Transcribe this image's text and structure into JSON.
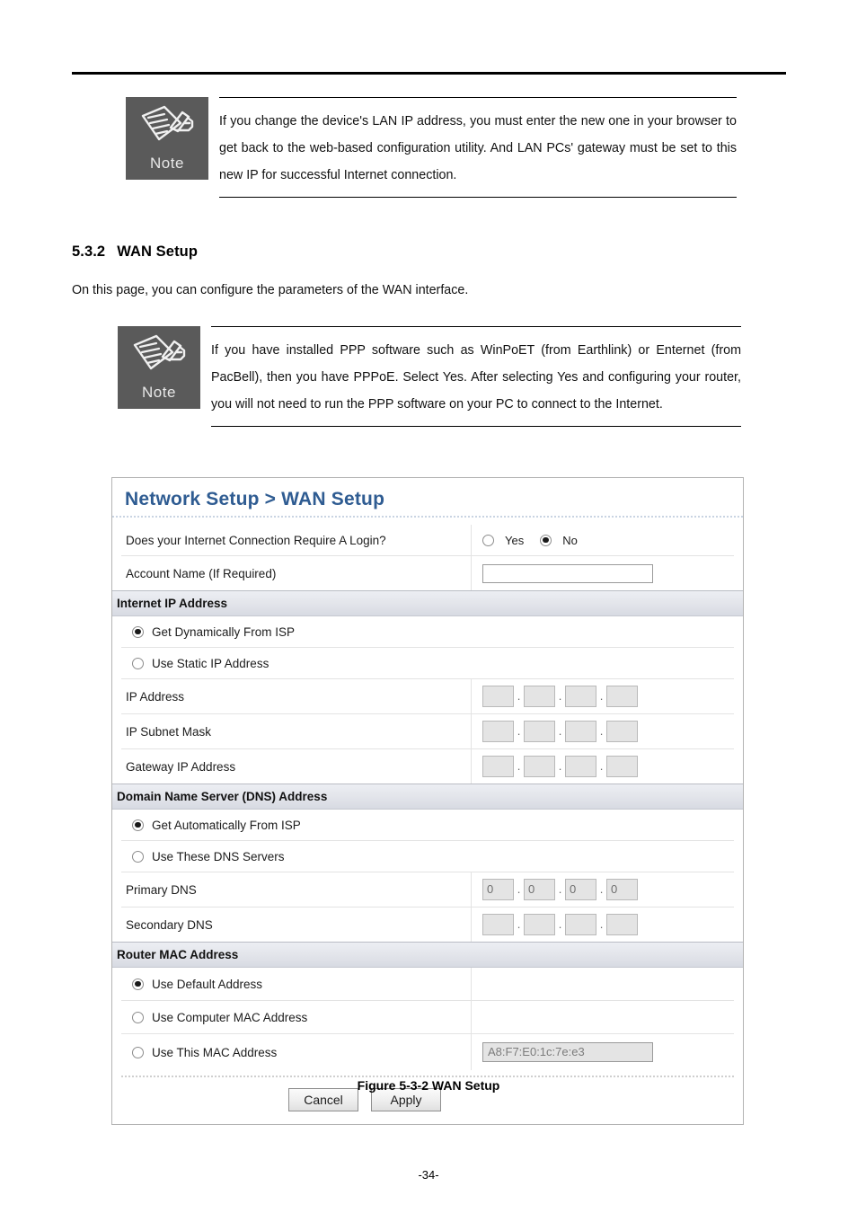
{
  "page": {
    "number": "-34-"
  },
  "notes": [
    {
      "icon_label": "Note",
      "text": "If you change the device's LAN IP address, you must enter the new one in your browser to get back to the web-based configuration utility. And LAN PCs' gateway must be set to this new IP for successful Internet connection."
    },
    {
      "icon_label": "Note",
      "text": "If you have installed PPP software such as WinPoET (from Earthlink) or Enternet (from PacBell), then you have PPPoE. Select Yes. After selecting Yes and configuring your router, you will not need to run the PPP software on your PC to connect to the Internet."
    }
  ],
  "section": {
    "number": "5.3.2",
    "title": "WAN Setup",
    "intro": "On this page, you can configure the parameters of the WAN interface."
  },
  "figure": {
    "caption": "Figure 5-3-2 WAN Setup"
  },
  "router_ui": {
    "title": "Network Setup > WAN Setup",
    "accent_color": "#2f5c92",
    "login_row": {
      "label": "Does your Internet Connection Require A Login?",
      "option_yes": "Yes",
      "option_no": "No",
      "selected": "No"
    },
    "account_row": {
      "label": "Account Name (If Required)",
      "value": "",
      "placeholder": ""
    },
    "internet_ip": {
      "section_title": "Internet IP Address",
      "option_dynamic": "Get Dynamically From ISP",
      "option_static": "Use Static IP Address",
      "selected": "Get Dynamically From ISP",
      "fields": [
        {
          "label": "IP Address",
          "octets": [
            "",
            "",
            "",
            ""
          ]
        },
        {
          "label": "IP Subnet Mask",
          "octets": [
            "",
            "",
            "",
            ""
          ]
        },
        {
          "label": "Gateway IP Address",
          "octets": [
            "",
            "",
            "",
            ""
          ]
        }
      ]
    },
    "dns": {
      "section_title": "Domain Name Server (DNS) Address",
      "option_auto": "Get Automatically From ISP",
      "option_manual": "Use These DNS Servers",
      "selected": "Get Automatically From ISP",
      "fields": [
        {
          "label": "Primary DNS",
          "octets": [
            "0",
            "0",
            "0",
            "0"
          ]
        },
        {
          "label": "Secondary DNS",
          "octets": [
            "",
            "",
            "",
            ""
          ]
        }
      ]
    },
    "router_mac": {
      "section_title": "Router MAC Address",
      "option_default": "Use Default Address",
      "option_computer": "Use Computer MAC Address",
      "option_this": "Use This MAC Address",
      "selected": "Use Default Address",
      "mac_value": "A8:F7:E0:1c:7e:e3"
    },
    "buttons": {
      "cancel": "Cancel",
      "apply": "Apply"
    },
    "separator": "."
  }
}
